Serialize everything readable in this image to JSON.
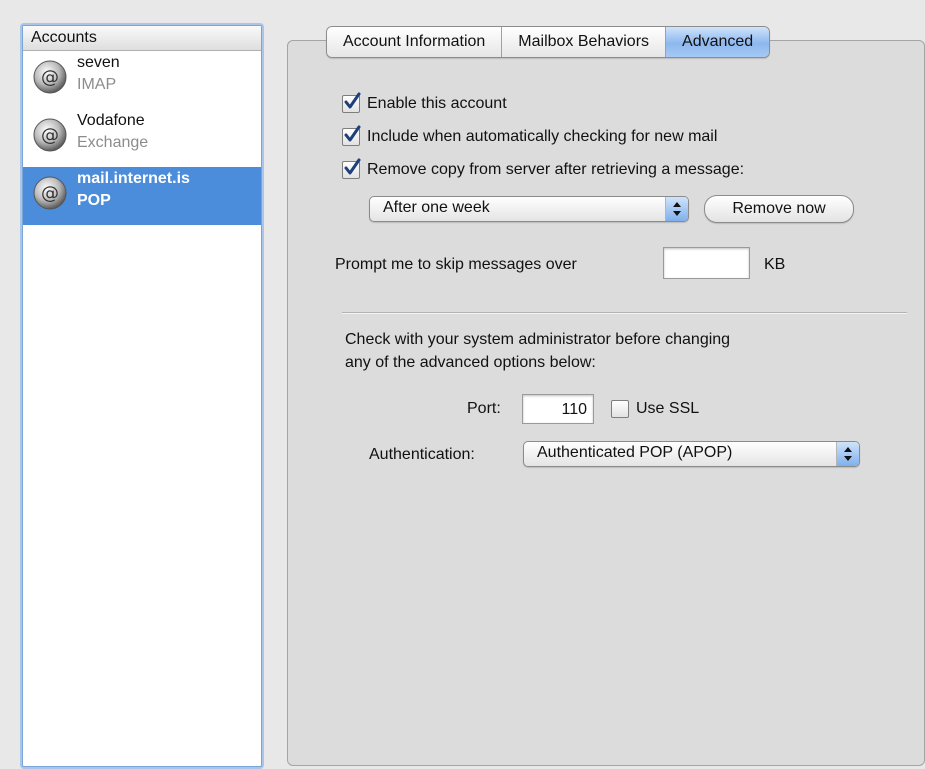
{
  "accounts": {
    "header": "Accounts",
    "items": [
      {
        "name": "seven",
        "type": "IMAP",
        "selected": false
      },
      {
        "name": "Vodafone",
        "type": "Exchange",
        "selected": false
      },
      {
        "name": "mail.internet.is",
        "type": "POP",
        "selected": true
      }
    ]
  },
  "tabs": [
    {
      "label": "Account Information",
      "active": false
    },
    {
      "label": "Mailbox Behaviors",
      "active": false
    },
    {
      "label": "Advanced",
      "active": true
    }
  ],
  "options": {
    "enable_account": {
      "label": "Enable this account",
      "checked": true
    },
    "include_auto_check": {
      "label": "Include when automatically checking for new mail",
      "checked": true
    },
    "remove_copy": {
      "label": "Remove copy from server after retrieving a message:",
      "checked": true
    }
  },
  "remove_after": {
    "selected": "After one week"
  },
  "remove_now_label": "Remove now",
  "skip_messages": {
    "label": "Prompt me to skip messages over",
    "value": "",
    "unit": "KB"
  },
  "advanced_note": {
    "line1": "Check with your system administrator before changing",
    "line2": "any of the advanced options below:"
  },
  "port": {
    "label": "Port:",
    "value": "110"
  },
  "ssl": {
    "label": "Use SSL",
    "checked": false
  },
  "authentication": {
    "label": "Authentication:",
    "selected": "Authenticated POP (APOP)"
  },
  "colors": {
    "selection": "#4b8ddb",
    "accent_blue": "#8db8ee"
  },
  "icons": [
    "at-sign-icon",
    "checkmark-icon",
    "popup-arrows-icon"
  ]
}
